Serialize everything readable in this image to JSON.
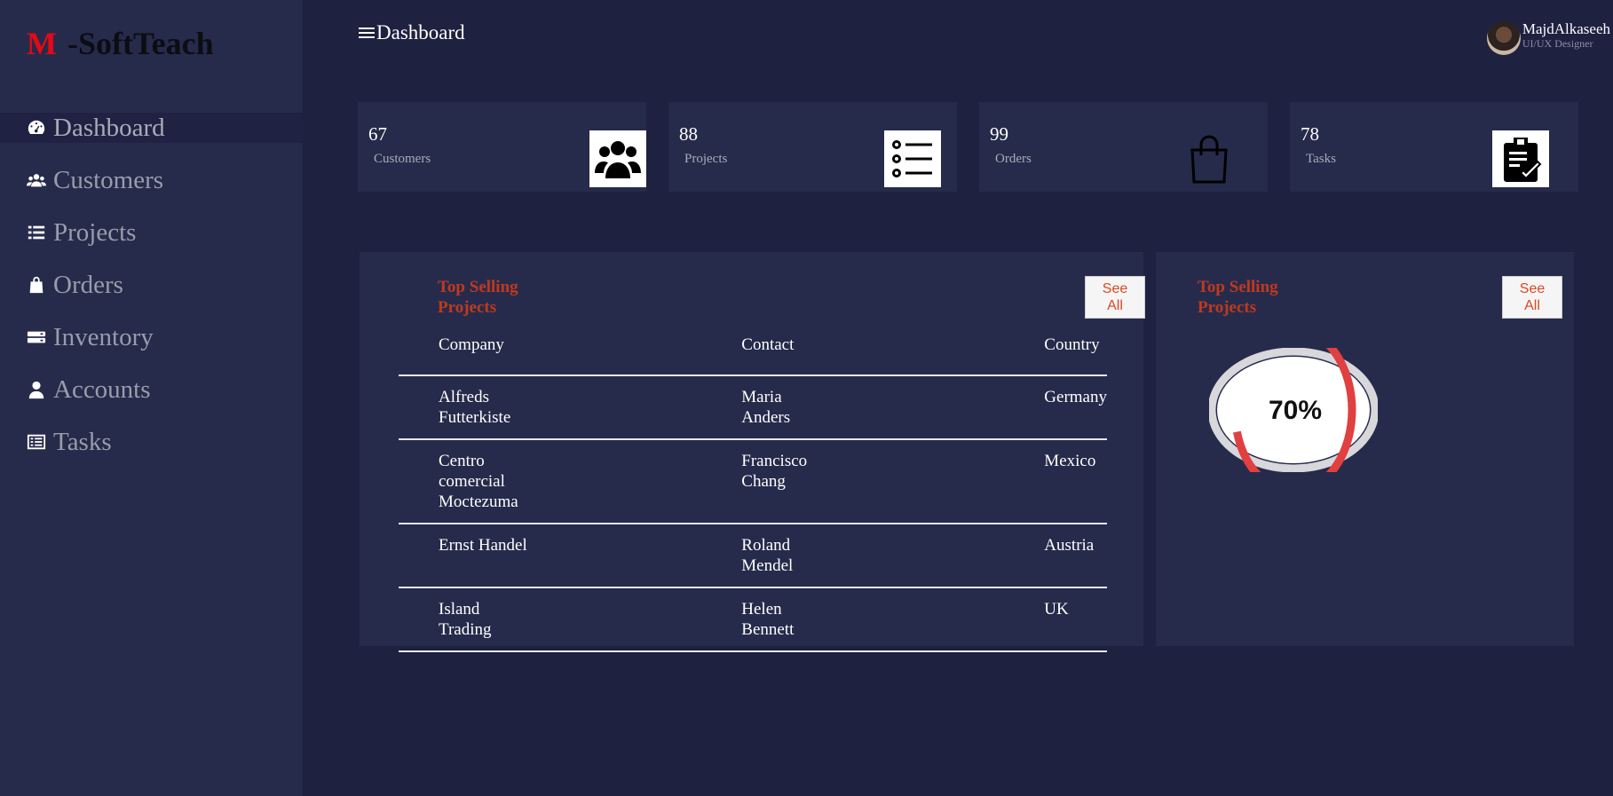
{
  "brand": {
    "letter": "M",
    "name": "-SoftTeach"
  },
  "nav": [
    {
      "label": "Dashboard",
      "icon": "gauge-icon"
    },
    {
      "label": "Customers",
      "icon": "users-icon"
    },
    {
      "label": "Projects",
      "icon": "list-icon"
    },
    {
      "label": "Orders",
      "icon": "shopping-bag-icon"
    },
    {
      "label": "Inventory",
      "icon": "server-icon"
    },
    {
      "label": "Accounts",
      "icon": "user-icon"
    },
    {
      "label": "Tasks",
      "icon": "task-list-icon"
    }
  ],
  "header": {
    "title": "Dashboard"
  },
  "user": {
    "name": "MajdAlkaseeh",
    "role": "UI/UX Designer"
  },
  "cards": [
    {
      "value": "67",
      "label": "Customers",
      "icon": "users-icon"
    },
    {
      "value": "88",
      "label": "Projects",
      "icon": "list-icon"
    },
    {
      "value": "99",
      "label": "Orders",
      "icon": "shopping-bag-icon"
    },
    {
      "value": "78",
      "label": "Tasks",
      "icon": "clipboard-check-icon"
    }
  ],
  "table_panel": {
    "title_line1": "Top Selling",
    "title_line2": "Projects",
    "see_all_line1": "See",
    "see_all_line2": "All",
    "headers": [
      "Company",
      "Contact",
      "Country"
    ],
    "rows": [
      {
        "company": [
          "Alfreds",
          "Futterkiste"
        ],
        "contact": [
          "Maria",
          "Anders"
        ],
        "country": "Germany"
      },
      {
        "company": [
          "Centro",
          "comercial",
          "Moctezuma"
        ],
        "contact": [
          "Francisco",
          "Chang"
        ],
        "country": "Mexico"
      },
      {
        "company": [
          "Ernst Handel"
        ],
        "contact": [
          "Roland",
          "Mendel"
        ],
        "country": "Austria"
      },
      {
        "company": [
          "Island",
          "Trading"
        ],
        "contact": [
          "Helen",
          "Bennett"
        ],
        "country": "UK"
      }
    ]
  },
  "chart_panel": {
    "title_line1": "Top Selling",
    "title_line2": "Projects",
    "see_all_line1": "See",
    "see_all_line2": "All",
    "progress_label": "70%",
    "progress_value": 0.7
  },
  "colors": {
    "accent": "#c0391f",
    "ring": "#e04040",
    "sidebar": "#262b4b",
    "background": "#1e2140"
  }
}
